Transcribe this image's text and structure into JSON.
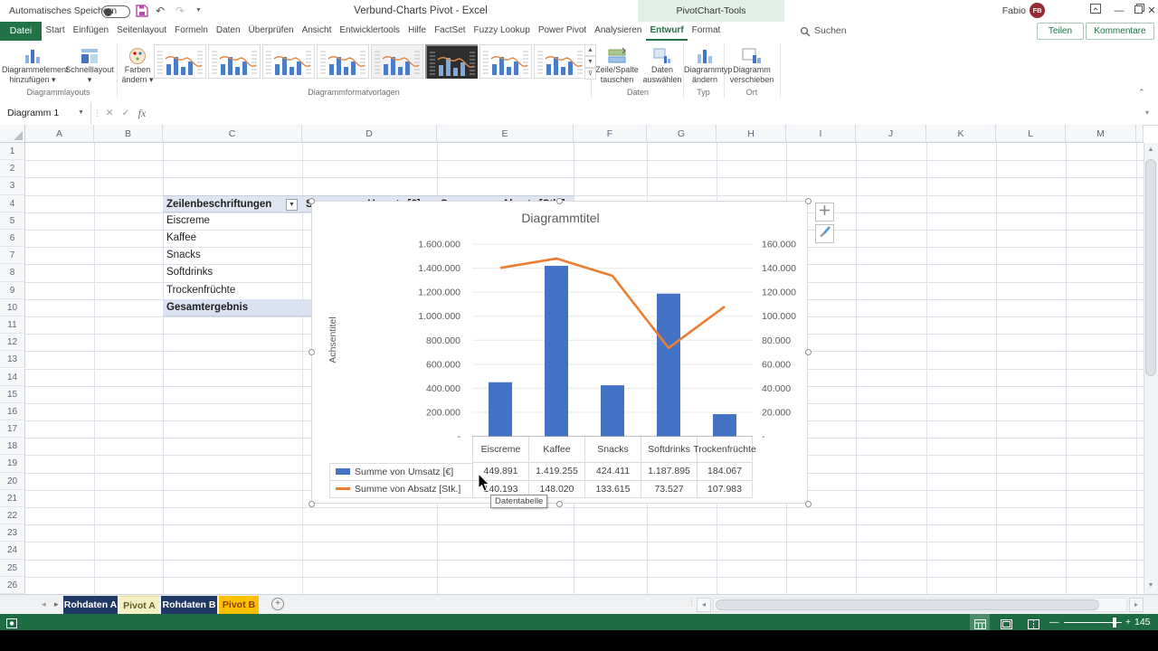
{
  "colors": {
    "excel_green": "#217346",
    "status_green": "#1E6C43",
    "bar_blue": "#4472C4",
    "line_orange": "#ED7D31",
    "tab_navy": "#1F3864",
    "tab_amber": "#FFC000",
    "pivot_header_fill": "#E0E6F1",
    "row_highlight_fill": "#DAE1F0"
  },
  "titlebar": {
    "autosave_label": "Automatisches Speichern",
    "doc_title": "Verbund-Charts Pivot - Excel",
    "contextual_label": "PivotChart-Tools",
    "user_name": "Fabio Basler",
    "user_initials": "FB"
  },
  "menu": {
    "file_tab": "Datei",
    "tabs": [
      "Start",
      "Einfügen",
      "Seitenlayout",
      "Formeln",
      "Daten",
      "Überprüfen",
      "Ansicht",
      "Entwicklertools",
      "Hilfe",
      "FactSet",
      "Fuzzy Lookup",
      "Power Pivot",
      "Analysieren",
      "Entwurf",
      "Format"
    ],
    "active_tab": "Entwurf",
    "search_label": "Suchen",
    "share_label": "Teilen",
    "comments_label": "Kommentare"
  },
  "ribbon": {
    "layouts": {
      "label": "Diagrammlayouts",
      "buttons": [
        "Diagrammelement hinzufügen",
        "Schnelllayout"
      ]
    },
    "styles": {
      "label": "Diagrammformatvorlagen",
      "color_button": "Farben ändern",
      "gallery_count": 8,
      "selected_index": 5
    },
    "daten": {
      "label": "Daten",
      "buttons": [
        "Zeile/Spalte tauschen",
        "Daten auswählen"
      ]
    },
    "typ": {
      "label": "Typ",
      "buttons": [
        "Diagrammtyp ändern"
      ]
    },
    "ort": {
      "label": "Ort",
      "buttons": [
        "Diagramm verschieben"
      ]
    }
  },
  "formula_bar": {
    "name_box": "Diagramm 1"
  },
  "grid": {
    "column_letters": [
      "A",
      "B",
      "C",
      "D",
      "E",
      "F",
      "G",
      "H",
      "I",
      "J",
      "K",
      "L",
      "M"
    ],
    "row_count": 26,
    "cells": [
      {
        "col": "C",
        "row": 4,
        "text": "Zeilenbeschriftungen",
        "bold": true,
        "fill": "header",
        "filter": true
      },
      {
        "col": "D",
        "row": 4,
        "text": "Summe von Umsatz [€]",
        "bold": true,
        "fill": "header"
      },
      {
        "col": "E",
        "row": 4,
        "text": "Summe von Absatz  [Stk.]",
        "bold": true,
        "fill": "header"
      },
      {
        "col": "C",
        "row": 5,
        "text": "Eiscreme"
      },
      {
        "col": "C",
        "row": 6,
        "text": "Kaffee"
      },
      {
        "col": "C",
        "row": 7,
        "text": "Snacks"
      },
      {
        "col": "C",
        "row": 8,
        "text": "Softdrinks"
      },
      {
        "col": "C",
        "row": 9,
        "text": "Trockenfrüchte"
      },
      {
        "col": "C",
        "row": 10,
        "text": "Gesamtergebnis",
        "bold": true,
        "fill": "highlight",
        "wide": true
      }
    ]
  },
  "chart_data": {
    "type": "combo-bar-line",
    "title": "Diagrammtitel",
    "axis_title": "Achsentitel",
    "categories": [
      "Eiscreme",
      "Kaffee",
      "Snacks",
      "Softdrinks",
      "Trockenfrüchte"
    ],
    "series": [
      {
        "name": "Summe von Umsatz [€]",
        "chart": "bar",
        "axis": "left",
        "color": "#4472C4",
        "values": [
          449891,
          1419255,
          424411,
          1187895,
          184067
        ]
      },
      {
        "name": "Summe von Absatz  [Stk.]",
        "chart": "line",
        "axis": "right",
        "color": "#ED7D31",
        "values": [
          140193,
          148020,
          133615,
          73527,
          107983
        ]
      }
    ],
    "left_axis": {
      "min": 0,
      "max": 1600000,
      "step": 200000
    },
    "right_axis": {
      "min": 0,
      "max": 160000,
      "step": 20000
    },
    "gridlines": true,
    "legend": "data-table"
  },
  "tooltip_label": "Datentabelle",
  "sheet_tabs": [
    {
      "label": "Rohdaten A",
      "style": "navy"
    },
    {
      "label": "Pivot A",
      "style": "active-yellow"
    },
    {
      "label": "Rohdaten B",
      "style": "navy"
    },
    {
      "label": "Pivot B",
      "style": "amber"
    }
  ],
  "status_bar": {
    "zoom_label": "145 %"
  }
}
